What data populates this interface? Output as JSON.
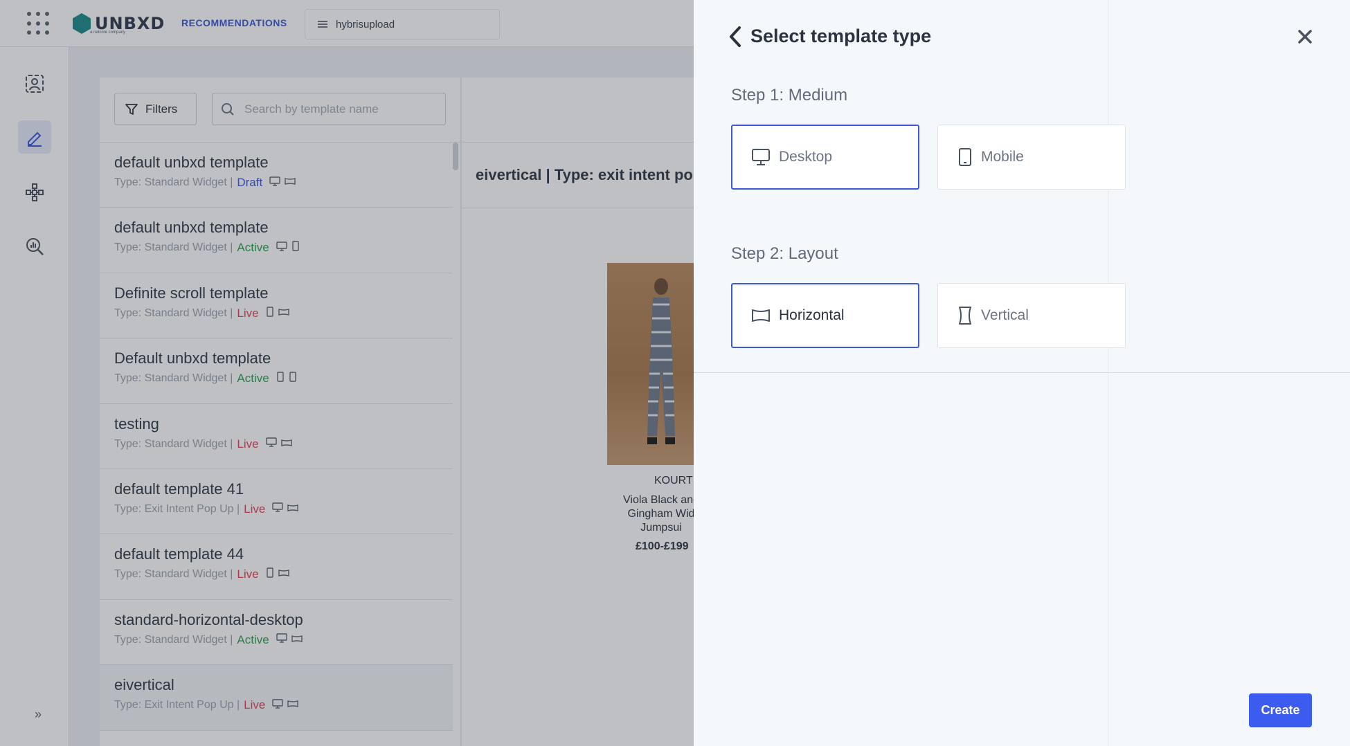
{
  "topbar": {
    "brand": "UNBXD",
    "brand_sub": "a netcore company",
    "module": "RECOMMENDATIONS",
    "site": "hybrisupload"
  },
  "sidebar": {
    "items": [
      {
        "name": "users-icon",
        "active": false
      },
      {
        "name": "pencil-icon",
        "active": true
      },
      {
        "name": "network-icon",
        "active": false
      },
      {
        "name": "analytics-icon",
        "active": false
      }
    ],
    "expand": "»"
  },
  "list": {
    "filters_label": "Filters",
    "search_placeholder": "Search by template name",
    "items": [
      {
        "name": "default unbxd template",
        "type": "Type: Standard Widget |",
        "status": "Draft",
        "status_kind": "draft",
        "devices": [
          "desktop",
          "horizontal"
        ]
      },
      {
        "name": "default unbxd template",
        "type": "Type: Standard Widget |",
        "status": "Active",
        "status_kind": "active",
        "devices": [
          "desktop",
          "mobile"
        ]
      },
      {
        "name": "Definite scroll template",
        "type": "Type: Standard Widget |",
        "status": "Live",
        "status_kind": "live",
        "devices": [
          "mobile",
          "horizontal"
        ]
      },
      {
        "name": "Default unbxd template",
        "type": "Type: Standard Widget |",
        "status": "Active",
        "status_kind": "active",
        "devices": [
          "mobile",
          "mobile"
        ]
      },
      {
        "name": "testing",
        "type": "Type: Standard Widget |",
        "status": "Live",
        "status_kind": "live",
        "devices": [
          "desktop",
          "horizontal"
        ]
      },
      {
        "name": "default template 41",
        "type": "Type: Exit Intent Pop Up |",
        "status": "Live",
        "status_kind": "live",
        "devices": [
          "desktop",
          "horizontal"
        ]
      },
      {
        "name": "default template 44",
        "type": "Type: Standard Widget |",
        "status": "Live",
        "status_kind": "live",
        "devices": [
          "mobile",
          "horizontal"
        ]
      },
      {
        "name": "standard-horizontal-desktop",
        "type": "Type: Standard Widget |",
        "status": "Active",
        "status_kind": "active",
        "devices": [
          "desktop",
          "horizontal"
        ]
      },
      {
        "name": "eivertical",
        "type": "Type: Exit Intent Pop Up |",
        "status": "Live",
        "status_kind": "live",
        "devices": [
          "desktop",
          "horizontal"
        ]
      }
    ]
  },
  "preview": {
    "title": "eivertical | Type: exit intent po",
    "product": {
      "brand": "KOURT",
      "name": "Viola Black and Gingham Wid Jumpsui",
      "price": "£100-£199"
    }
  },
  "drawer": {
    "title": "Select template type",
    "step1_label": "Step 1: Medium",
    "step2_label": "Step 2: Layout",
    "medium_options": [
      {
        "label": "Desktop",
        "icon": "desktop-icon",
        "selected": true
      },
      {
        "label": "Mobile",
        "icon": "mobile-icon",
        "selected": false
      }
    ],
    "layout_options": [
      {
        "label": "Horizontal",
        "icon": "horizontal-layout-icon",
        "selected": true
      },
      {
        "label": "Vertical",
        "icon": "vertical-layout-icon",
        "selected": false
      }
    ],
    "create_label": "Create"
  },
  "colors": {
    "accent": "#3b58d6",
    "create_button": "#3c5cf0",
    "status_draft": "#3b58d6",
    "status_active": "#2e9e4f",
    "status_live": "#e6405a"
  }
}
